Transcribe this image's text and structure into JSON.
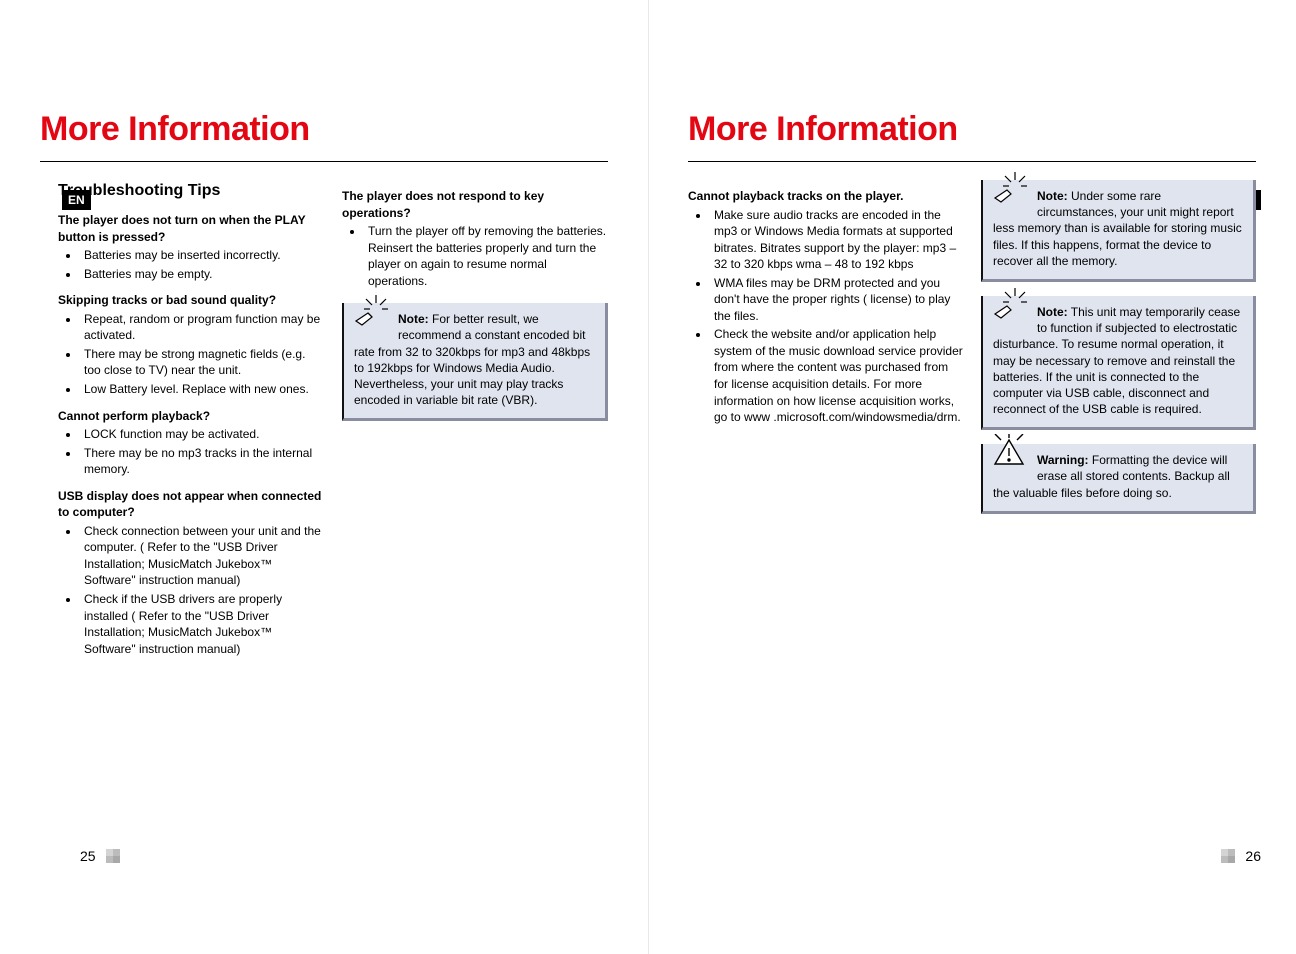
{
  "lang": "EN",
  "page_left_num": "25",
  "page_right_num": "26",
  "left": {
    "title": "More Information",
    "subhead": "Troubleshooting Tips",
    "sections": [
      {
        "q": "The player does not turn on when the PLAY button is pressed?",
        "items": [
          "Batteries may be inserted incorrectly.",
          "Batteries may be empty."
        ]
      },
      {
        "q": "Skipping tracks or bad sound quality?",
        "items": [
          "Repeat, random or program function may be activated.",
          "There may be strong magnetic fields (e.g. too close to TV) near the unit.",
          "Low Battery level. Replace with new ones."
        ]
      },
      {
        "q": "Cannot perform playback?",
        "items": [
          "LOCK function may be activated.",
          "There may be no mp3 tracks in the internal memory."
        ]
      },
      {
        "q": "USB display does not appear when connected to computer?",
        "items": [
          "Check connection between your unit and the computer. ( Refer to the \"USB Driver Installation; MusicMatch Jukebox™ Software\"  instruction manual)",
          "Check if the USB drivers are properly installed ( Refer to the \"USB Driver Installation; MusicMatch Jukebox™ Software\"  instruction manual)"
        ]
      }
    ],
    "col2": {
      "q": "The player does not respond to key operations?",
      "items": [
        "Turn the player off by removing the batteries. Reinsert the batteries properly and turn the player on again to resume normal operations."
      ],
      "note_label": "Note:",
      "note_body1": "For better result, we recommend a constant encoded bit rate from 32 to 320kbps for mp3 and 48kbps to 192kbps for Windows Media Audio.",
      "note_body2": "Nevertheless, your unit may play tracks encoded in variable bit rate (VBR)."
    }
  },
  "right": {
    "title": "More Information",
    "col1": {
      "q": "Cannot playback tracks on the player.",
      "items": [
        "Make sure audio tracks are encoded in the mp3 or Windows Media formats at supported bitrates. Bitrates support by the player: mp3 – 32 to 320 kbps wma – 48 to 192 kbps",
        "WMA files may be DRM protected and you don't have the proper rights ( license) to play the files.",
        "Check the website and/or application help system of the music download service provider from where the content was purchased from for license acquisition details. For more information on how license acquisition works, go to www .microsoft.com/windowsmedia/drm."
      ]
    },
    "notes": [
      {
        "label": "Note:",
        "icon": "hand-note",
        "body": "Under some rare circumstances, your unit might report less memory than is available for storing music files. If this happens, format the device to recover all the memory."
      },
      {
        "label": "Note:",
        "icon": "hand-note",
        "body": "This unit may temporarily cease to function if subjected to electrostatic disturbance. To resume normal operation, it may be necessary to remove and reinstall the batteries. If the unit is connected to the computer via USB cable, disconnect and reconnect of the USB cable is required."
      },
      {
        "label": "Warning:",
        "icon": "warning",
        "body": "Formatting the device will erase all stored  contents. Backup all the valuable files before doing so."
      }
    ]
  }
}
